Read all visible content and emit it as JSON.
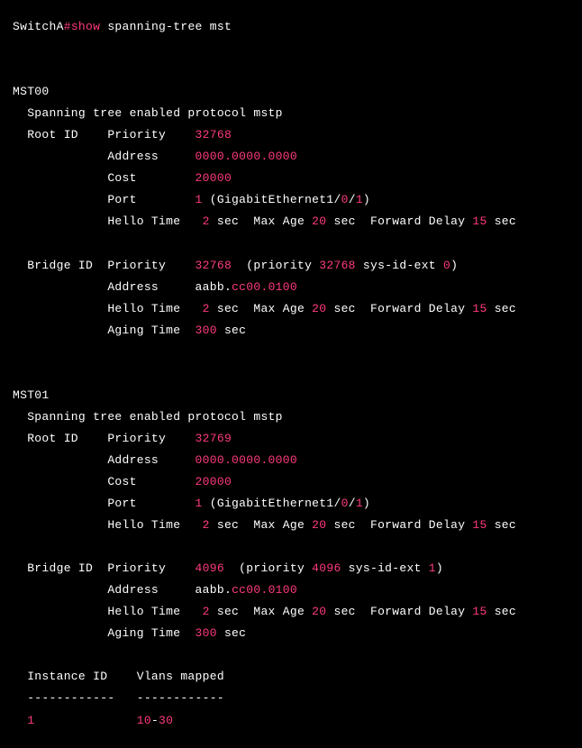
{
  "prompt": {
    "host": "SwitchA",
    "sep": "#",
    "cmd_highlight": "show",
    "cmd_tail": " spanning-tree mst"
  },
  "instances": [
    {
      "name": "MST00",
      "protocol_line": "  Spanning tree enabled protocol mstp",
      "root": {
        "label": "  Root ID    ",
        "priority_label": "Priority    ",
        "priority": "32768",
        "address_label": "             Address     ",
        "address": "0000.0000.0000",
        "cost_label": "             Cost        ",
        "cost": "20000",
        "port_label": "             Port        ",
        "port_num": "1",
        "port_tail_a": " (GigabitEthernet1/",
        "port_mid": "0",
        "port_tail_b": "/",
        "port_last": "1",
        "port_close": ")",
        "hello_label": "             Hello Time   ",
        "hello": "2",
        "hello_unit": " sec  Max Age ",
        "maxage": "20",
        "maxage_unit": " sec  Forward Delay ",
        "fwd": "15",
        "fwd_unit": " sec"
      },
      "bridge": {
        "label": "  Bridge ID  ",
        "priority_label": "Priority    ",
        "priority": "32768",
        "priority_tail_a": "  (priority ",
        "priority_inner": "32768",
        "priority_tail_b": " sys-id-ext ",
        "sysid": "0",
        "priority_close": ")",
        "address_label": "             Address     ",
        "address_a": "aabb.",
        "address_b": "cc00.0100",
        "hello_label": "             Hello Time   ",
        "hello": "2",
        "hello_unit": " sec  Max Age ",
        "maxage": "20",
        "maxage_unit": " sec  Forward Delay ",
        "fwd": "15",
        "fwd_unit": " sec",
        "aging_label": "             Aging Time  ",
        "aging": "300",
        "aging_unit": " sec"
      }
    },
    {
      "name": "MST01",
      "protocol_line": "  Spanning tree enabled protocol mstp",
      "root": {
        "label": "  Root ID    ",
        "priority_label": "Priority    ",
        "priority": "32769",
        "address_label": "             Address     ",
        "address": "0000.0000.0000",
        "cost_label": "             Cost        ",
        "cost": "20000",
        "port_label": "             Port        ",
        "port_num": "1",
        "port_tail_a": " (GigabitEthernet1/",
        "port_mid": "0",
        "port_tail_b": "/",
        "port_last": "1",
        "port_close": ")",
        "hello_label": "             Hello Time   ",
        "hello": "2",
        "hello_unit": " sec  Max Age ",
        "maxage": "20",
        "maxage_unit": " sec  Forward Delay ",
        "fwd": "15",
        "fwd_unit": " sec"
      },
      "bridge": {
        "label": "  Bridge ID  ",
        "priority_label": "Priority    ",
        "priority": "4096",
        "priority_tail_a": "  (priority ",
        "priority_inner": "4096",
        "priority_tail_b": " sys-id-ext ",
        "sysid": "1",
        "priority_close": ")",
        "address_label": "             Address     ",
        "address_a": "aabb.",
        "address_b": "cc00.0100",
        "hello_label": "             Hello Time   ",
        "hello": "2",
        "hello_unit": " sec  Max Age ",
        "maxage": "20",
        "maxage_unit": " sec  Forward Delay ",
        "fwd": "15",
        "fwd_unit": " sec",
        "aging_label": "             Aging Time  ",
        "aging": "300",
        "aging_unit": " sec"
      }
    }
  ],
  "vlan_table": {
    "header": "  Instance ID    Vlans mapped",
    "divider": "  ------------   ------------",
    "row_prefix": "  ",
    "instance": "1",
    "gap": "              ",
    "range_start": "10",
    "range_sep": "-",
    "range_end": "30"
  }
}
